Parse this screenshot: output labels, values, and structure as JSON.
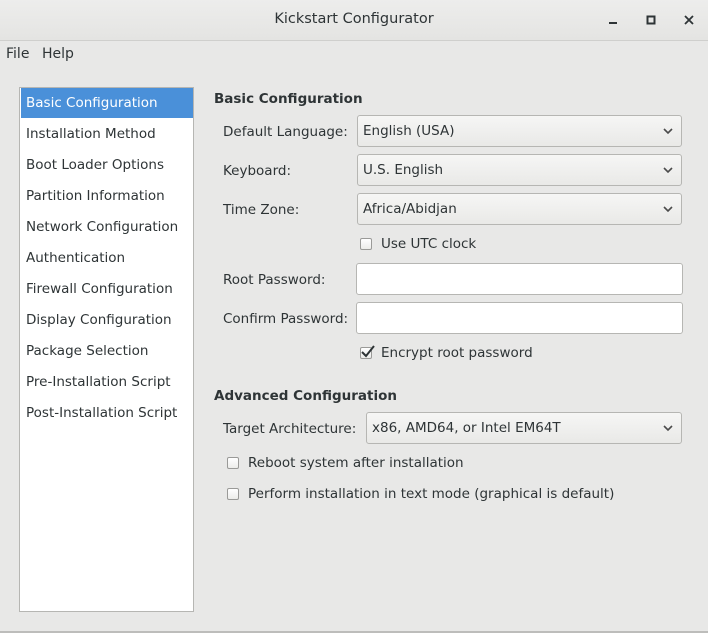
{
  "window": {
    "title": "Kickstart Configurator"
  },
  "menubar": {
    "file": "File",
    "help": "Help"
  },
  "sidebar": {
    "items": [
      {
        "label": "Basic Configuration",
        "selected": true
      },
      {
        "label": "Installation Method"
      },
      {
        "label": "Boot Loader Options"
      },
      {
        "label": "Partition Information"
      },
      {
        "label": "Network Configuration"
      },
      {
        "label": "Authentication"
      },
      {
        "label": "Firewall Configuration"
      },
      {
        "label": "Display Configuration"
      },
      {
        "label": "Package Selection"
      },
      {
        "label": "Pre-Installation Script"
      },
      {
        "label": "Post-Installation Script"
      }
    ]
  },
  "basic": {
    "title": "Basic Configuration",
    "language_label": "Default Language:",
    "language_value": "English (USA)",
    "keyboard_label": "Keyboard:",
    "keyboard_value": "U.S. English",
    "timezone_label": "Time Zone:",
    "timezone_value": "Africa/Abidjan",
    "utc_label": "Use UTC clock",
    "utc_checked": false,
    "root_password_label": "Root Password:",
    "root_password_value": "",
    "confirm_password_label": "Confirm Password:",
    "confirm_password_value": "",
    "encrypt_label": "Encrypt root password",
    "encrypt_checked": true
  },
  "advanced": {
    "title": "Advanced Configuration",
    "arch_label": "Target Architecture:",
    "arch_value": "x86, AMD64, or Intel EM64T",
    "reboot_label": "Reboot system after installation",
    "reboot_checked": false,
    "textmode_label": "Perform installation in text mode (graphical is default)",
    "textmode_checked": false
  },
  "colors": {
    "selection": "#4a90d9",
    "window_bg": "#e8e8e7"
  }
}
